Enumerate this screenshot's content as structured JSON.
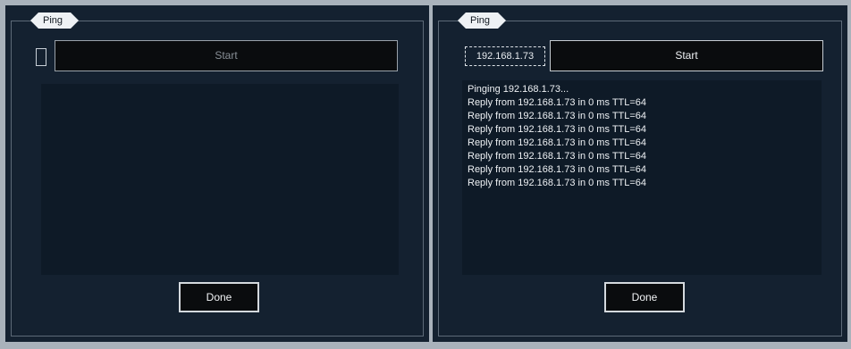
{
  "left": {
    "title": "Ping",
    "ip_value": "",
    "start_label": "Start",
    "done_label": "Done",
    "output_lines": []
  },
  "right": {
    "title": "Ping",
    "ip_value": "192.168.1.73",
    "start_label": "Start",
    "done_label": "Done",
    "output_lines": [
      "Pinging 192.168.1.73...",
      "Reply from 192.168.1.73 in 0 ms TTL=64",
      "Reply from 192.168.1.73 in 0 ms TTL=64",
      "Reply from 192.168.1.73 in 0 ms TTL=64",
      "Reply from 192.168.1.73 in 0 ms TTL=64",
      "Reply from 192.168.1.73 in 0 ms TTL=64",
      "Reply from 192.168.1.73 in 0 ms TTL=64",
      "Reply from 192.168.1.73 in 0 ms TTL=64"
    ]
  }
}
